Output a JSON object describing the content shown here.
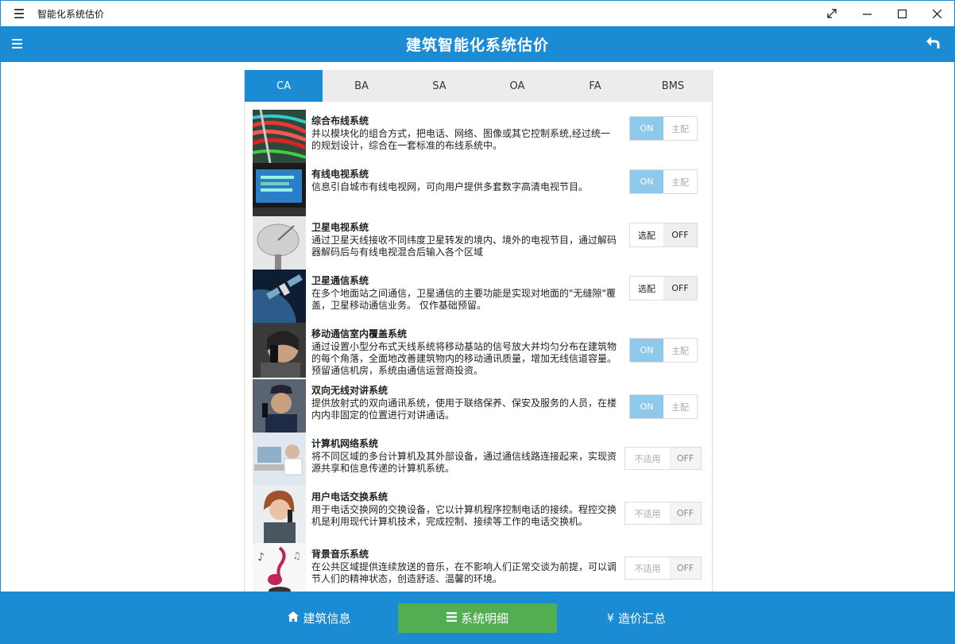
{
  "window": {
    "title": "智能化系统估价",
    "menu_icon": "hamburger-icon",
    "controls": [
      "restore-icon",
      "minimize-icon",
      "maximize-icon",
      "close-icon"
    ]
  },
  "header": {
    "title": "建筑智能化系统估价",
    "menu_icon": "hamburger-icon",
    "back_icon": "back-arrow-icon",
    "color": "#1b8bd3"
  },
  "tabs": [
    {
      "label": "CA",
      "active": true
    },
    {
      "label": "BA",
      "active": false
    },
    {
      "label": "SA",
      "active": false
    },
    {
      "label": "OA",
      "active": false
    },
    {
      "label": "FA",
      "active": false
    },
    {
      "label": "BMS",
      "active": false
    }
  ],
  "systems": [
    {
      "name": "综合布线系统",
      "desc": "并以模块化的组合方式，把电话、网络、图像或其它控制系统,经过统一的规划设计，综合在一套标准的布线系统中。",
      "toggle": {
        "left": "ON",
        "right": "主配",
        "state": "on"
      }
    },
    {
      "name": "有线电视系统",
      "desc": "信息引自城市有线电视网，可向用户提供多套数字高清电视节目。",
      "toggle": {
        "left": "ON",
        "right": "主配",
        "state": "on"
      }
    },
    {
      "name": "卫星电视系统",
      "desc": "通过卫星天线接收不同纬度卫星转发的境内、境外的电视节目，通过解码器解码后与有线电视混合后输入各个区域",
      "toggle": {
        "left": "选配",
        "right": "OFF",
        "state": "off"
      }
    },
    {
      "name": "卫星通信系统",
      "desc": "在多个地面站之间通信，卫星通信的主要功能是实现对地面的\"无缝隙\"覆盖，卫星移动通信业务。 仅作基础预留。",
      "toggle": {
        "left": "选配",
        "right": "OFF",
        "state": "off"
      }
    },
    {
      "name": "移动通信室内覆盖系统",
      "desc": "通过设置小型分布式天线系统将移动基站的信号放大并均匀分布在建筑物的每个角落，全面地改善建筑物内的移动通讯质量，增加无线信道容量。 预留通信机房，系统由通信运营商投资。",
      "toggle": {
        "left": "ON",
        "right": "主配",
        "state": "on"
      }
    },
    {
      "name": "双向无线对讲系统",
      "desc": "提供放射式的双向通讯系统，使用于联络保养、保安及服务的人员，在楼内内非固定的位置进行对讲通话。",
      "toggle": {
        "left": "ON",
        "right": "主配",
        "state": "on"
      }
    },
    {
      "name": "计算机网络系统",
      "desc": "将不同区域的多台计算机及其外部设备，通过通信线路连接起来，实现资源共享和信息传递的计算机系统。",
      "toggle": {
        "left": "不适用",
        "right": "OFF",
        "state": "na"
      }
    },
    {
      "name": "用户电话交换系统",
      "desc": "用于电话交换网的交换设备，它以计算机程序控制电话的接续。程控交换机是利用现代计算机技术，完成控制、接续等工作的电话交换机。",
      "toggle": {
        "left": "不适用",
        "right": "OFF",
        "state": "na"
      }
    },
    {
      "name": "背景音乐系统",
      "desc": "在公共区域提供连续放送的音乐，在不影响人们正常交谈为前提，可以调节人们的精神状态，创造舒适、温馨的环境。",
      "toggle": {
        "left": "不适用",
        "right": "OFF",
        "state": "na"
      }
    }
  ],
  "footer": {
    "buttons": [
      {
        "label": "建筑信息",
        "icon": "home-icon",
        "active": false
      },
      {
        "label": "系统明细",
        "icon": "list-icon",
        "active": true
      },
      {
        "label": "造价汇总",
        "icon": "yen-icon",
        "active": false
      }
    ],
    "active_color": "#52ae50"
  }
}
